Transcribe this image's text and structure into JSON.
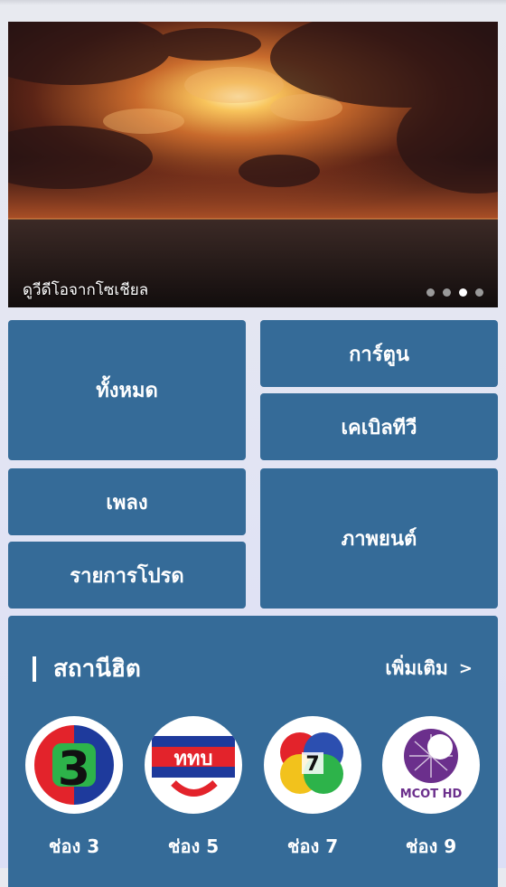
{
  "banner": {
    "caption": "ดูวีดีโอจากโซเชียล",
    "slide_count": 4,
    "active_slide": 3
  },
  "categories": {
    "all": "ทั้งหมด",
    "cartoon": "การ์ตูน",
    "cable_tv": "เคเบิลทีวี",
    "music": "เพลง",
    "movies": "ภาพยนต์",
    "favorites": "รายการโปรด"
  },
  "hits": {
    "title": "สถานีฮิต",
    "more_label": "เพิ่มเติม",
    "more_icon": "chevron-right-icon",
    "channels": [
      {
        "label": "ช่อง 3",
        "logo_text": "3"
      },
      {
        "label": "ช่อง 5",
        "logo_text": "ททบ"
      },
      {
        "label": "ช่อง 7",
        "logo_text": "7"
      },
      {
        "label": "ช่อง 9",
        "logo_text": "MCOT HD"
      }
    ]
  },
  "colors": {
    "tile": "#356b98",
    "background": "#e4e6f4"
  }
}
